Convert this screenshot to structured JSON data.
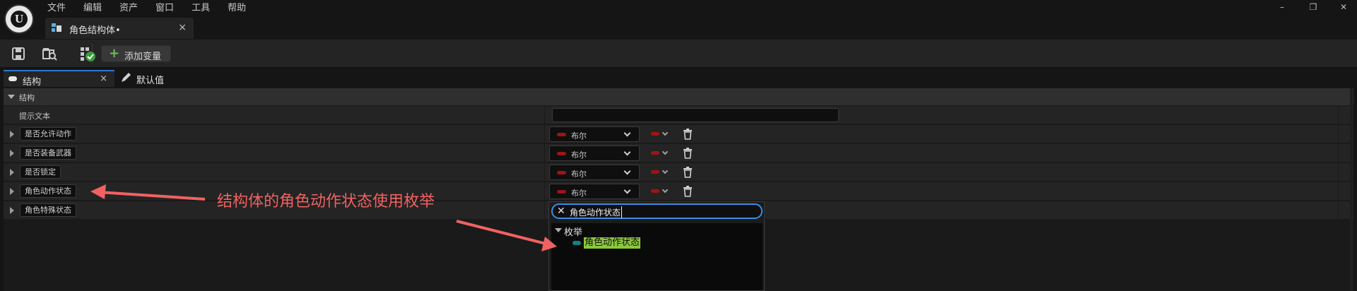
{
  "menu": [
    "文件",
    "编辑",
    "资产",
    "窗口",
    "工具",
    "帮助"
  ],
  "document_tab": {
    "label": "角色结构体•",
    "close": "×"
  },
  "toolbar": {
    "add_variable_label": "添加变量",
    "add_variable_icon": "plus-icon"
  },
  "panel_tabs": [
    {
      "label": "结构",
      "close": "×",
      "icon": "struct-icon"
    },
    {
      "label": "默认值",
      "icon": "pencil-icon"
    }
  ],
  "details": {
    "section_label": "结构",
    "hint_text_label": "提示文本",
    "hint_text_value": "",
    "variables": [
      {
        "name": "是否允许动作",
        "type": "布尔"
      },
      {
        "name": "是否装备武器",
        "type": "布尔"
      },
      {
        "name": "是否锁定",
        "type": "布尔"
      },
      {
        "name": "角色动作状态",
        "type": "布尔"
      },
      {
        "name": "角色特殊状态",
        "type": null
      }
    ]
  },
  "type_popup": {
    "search_query": "角色动作状态",
    "category": "枚举",
    "options": [
      "角色动作状态"
    ]
  },
  "annotation": {
    "text": "结构体的角色动作状态使用枚举",
    "color": "#f06262"
  },
  "colors": {
    "bool_pin": "#a01414",
    "enum_pin": "#158080",
    "highlight": "#8cc83c",
    "accent": "#2b78d0"
  }
}
